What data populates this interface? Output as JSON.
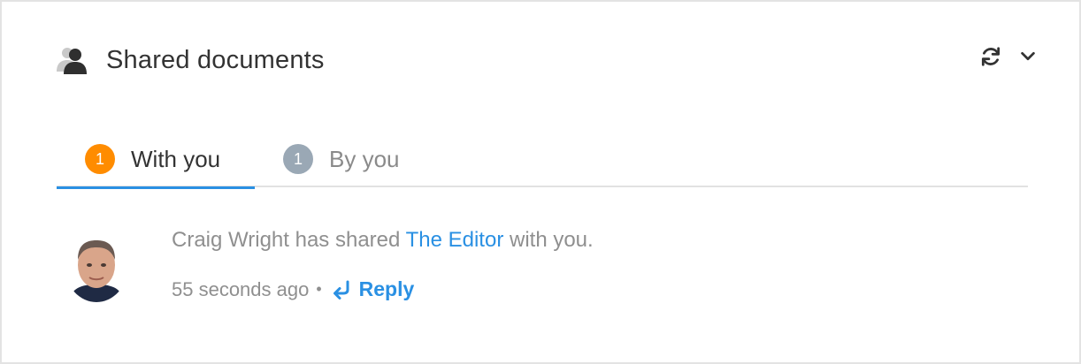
{
  "header": {
    "title": "Shared documents",
    "icon": "users-icon",
    "actions": [
      {
        "name": "refresh",
        "icon": "refresh-icon"
      },
      {
        "name": "collapse",
        "icon": "chevron-down-icon"
      }
    ]
  },
  "tabs": [
    {
      "label": "With you",
      "count": "1",
      "badge_color": "#ff8c00",
      "active": true
    },
    {
      "label": "By you",
      "count": "1",
      "badge_color": "#9aa8b5",
      "active": false
    }
  ],
  "activity": {
    "user": "Craig Wright",
    "action_text": " has shared ",
    "document": "The Editor",
    "suffix": " with you.",
    "time": "55 seconds ago",
    "separator": "•",
    "reply_label": "Reply"
  },
  "colors": {
    "accent": "#2a90e3",
    "muted_text": "#8f8f8f",
    "border": "#e3e3e3"
  }
}
